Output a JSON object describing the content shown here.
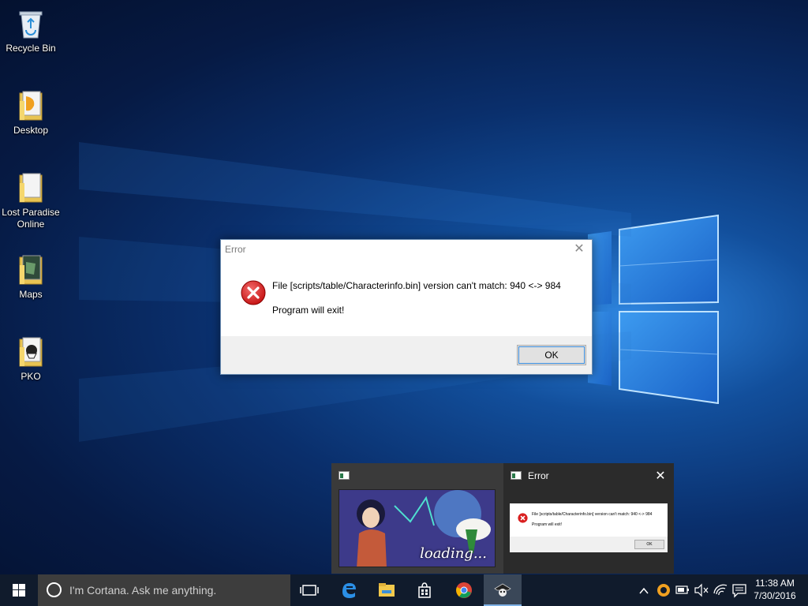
{
  "desktop": {
    "icons": [
      {
        "label": "Recycle Bin",
        "icon": "recycle-bin-icon"
      },
      {
        "label": "Desktop",
        "icon": "folder-icon"
      },
      {
        "label": "Lost Paradise Online",
        "icon": "folder-icon"
      },
      {
        "label": "Maps",
        "icon": "folder-icon"
      },
      {
        "label": "PKO",
        "icon": "folder-icon"
      }
    ]
  },
  "dialog": {
    "title": "Error",
    "message": "File [scripts/table/Characterinfo.bin] version can't match: 940 <-> 984",
    "message2": "Program will exit!",
    "ok_label": "OK",
    "icon": "error-icon"
  },
  "thumbnails": {
    "loading_text": "loading...",
    "error_title": "Error",
    "mini_message": "File [scripts/table/Characterinfo.bin] version can't match: 940 <-> 984",
    "mini_message2": "Program will exit!",
    "mini_ok": "OK"
  },
  "taskbar": {
    "search_placeholder": "I'm Cortana. Ask me anything.",
    "pinned": [
      "task-view-icon",
      "edge-icon",
      "file-explorer-icon",
      "store-icon",
      "chrome-icon",
      "pko-icon"
    ],
    "time": "11:38 AM",
    "date": "7/30/2016"
  },
  "colors": {
    "accent": "#3c8fe0",
    "taskbar": "#101b2c",
    "error_red": "#d92020"
  }
}
